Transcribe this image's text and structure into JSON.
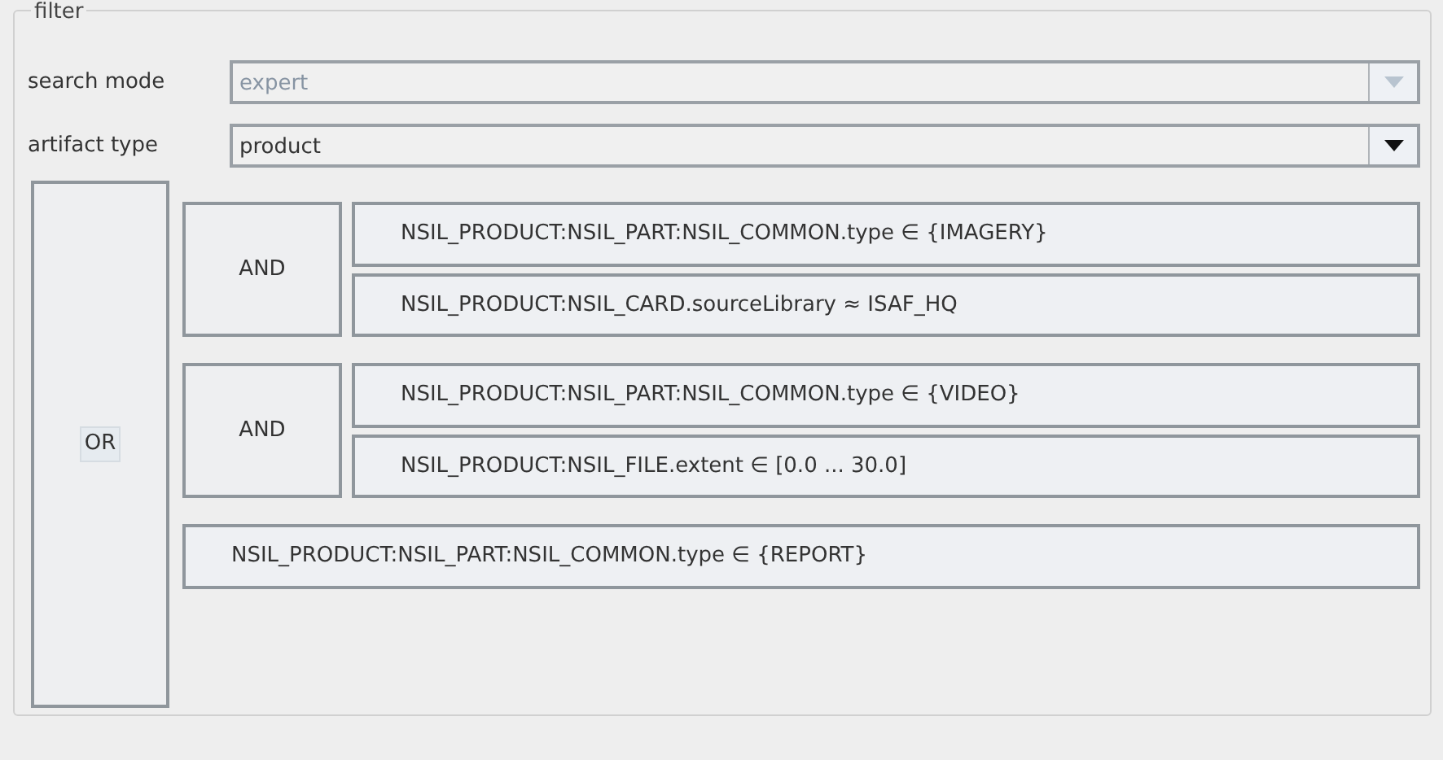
{
  "filter": {
    "legend": "filter",
    "fields": [
      {
        "label": "search mode",
        "value": "expert",
        "disabled": true
      },
      {
        "label": "artifact type",
        "value": "product",
        "disabled": false
      }
    ],
    "query": {
      "operator": "OR",
      "children": [
        {
          "kind": "and",
          "operator": "AND",
          "children": [
            {
              "kind": "condition",
              "text": "NSIL_PRODUCT:NSIL_PART:NSIL_COMMON.type ∈ {IMAGERY}"
            },
            {
              "kind": "condition",
              "text": "NSIL_PRODUCT:NSIL_CARD.sourceLibrary ≈ ISAF_HQ"
            }
          ]
        },
        {
          "kind": "and",
          "operator": "AND",
          "children": [
            {
              "kind": "condition",
              "text": "NSIL_PRODUCT:NSIL_PART:NSIL_COMMON.type ∈ {VIDEO}"
            },
            {
              "kind": "condition",
              "text": "NSIL_PRODUCT:NSIL_FILE.extent ∈ [0.0 ... 30.0]"
            }
          ]
        },
        {
          "kind": "condition",
          "text": "NSIL_PRODUCT:NSIL_PART:NSIL_COMMON.type ∈ {REPORT}"
        }
      ]
    }
  }
}
